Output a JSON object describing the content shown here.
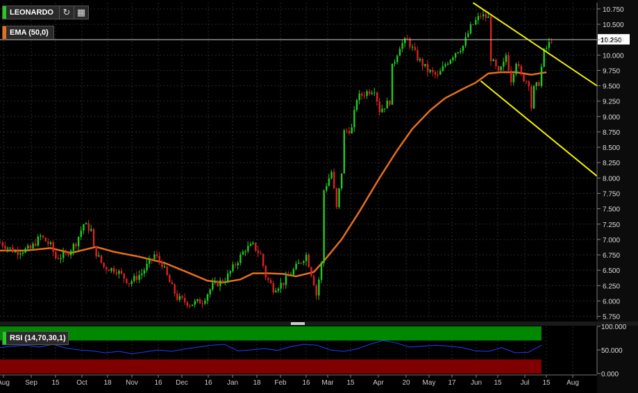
{
  "instrument": "LEONARDO",
  "indicators": {
    "ema_label": "EMA (50,0)",
    "rsi_label": "RSI (14,70,30,1)"
  },
  "icons": {
    "refresh": "refresh-icon",
    "calendar": "calendar-icon"
  },
  "colors": {
    "up": "#22cc22",
    "down": "#dd2222",
    "ema": "#e8701a",
    "channel": "#f0f000",
    "rsi_line": "#1f3fff",
    "rsi_overbought": "#008800",
    "rsi_oversold": "#800000",
    "instrument_accent": "#22cc22",
    "ema_accent": "#e8701a",
    "rsi_accent": "#22cc22"
  },
  "chart_data": [
    {
      "type": "candlestick",
      "series": [
        {
          "name": "LEONARDO"
        },
        {
          "name": "EMA (50,0)"
        }
      ],
      "ylim": [
        5.7,
        10.85
      ],
      "y_ticks": [
        "10.750",
        "10.500",
        "10.250",
        "10.000",
        "9.750",
        "9.500",
        "9.250",
        "9.000",
        "8.750",
        "8.500",
        "8.250",
        "8.000",
        "7.750",
        "7.500",
        "7.250",
        "7.000",
        "6.750",
        "6.500",
        "6.250",
        "6.000",
        "5.750"
      ],
      "x_ticks": [
        "Aug",
        "Sep",
        "15",
        "Oct",
        "18",
        "Nov",
        "16",
        "Dec",
        "16",
        "Jan",
        "18",
        "Feb",
        "16",
        "Mar",
        "15",
        "Apr",
        "20",
        "May",
        "17",
        "Jun",
        "15",
        "Jul",
        "15",
        "Aug"
      ],
      "last_price": "10.250",
      "price_path": [
        [
          0,
          6.95
        ],
        [
          6,
          6.8
        ],
        [
          12,
          6.85
        ],
        [
          16,
          7.05
        ],
        [
          20,
          6.9
        ],
        [
          22,
          6.7
        ],
        [
          26,
          6.75
        ],
        [
          30,
          6.95
        ],
        [
          33,
          7.25
        ],
        [
          36,
          7.15
        ],
        [
          37,
          6.85
        ],
        [
          41,
          6.55
        ],
        [
          46,
          6.5
        ],
        [
          51,
          6.3
        ],
        [
          56,
          6.45
        ],
        [
          61,
          6.75
        ],
        [
          64,
          6.6
        ],
        [
          67,
          6.3
        ],
        [
          70,
          6.05
        ],
        [
          75,
          5.95
        ],
        [
          80,
          6.0
        ],
        [
          84,
          6.25
        ],
        [
          89,
          6.35
        ],
        [
          93,
          6.6
        ],
        [
          97,
          6.85
        ],
        [
          100,
          6.9
        ],
        [
          103,
          6.75
        ],
        [
          105,
          6.4
        ],
        [
          108,
          6.2
        ],
        [
          112,
          6.3
        ],
        [
          117,
          6.55
        ],
        [
          121,
          6.75
        ],
        [
          124,
          6.3
        ],
        [
          125,
          6.1
        ],
        [
          127,
          6.6
        ],
        [
          128,
          7.8
        ],
        [
          131,
          8.1
        ],
        [
          133,
          7.5
        ],
        [
          135,
          8.1
        ],
        [
          136,
          8.75
        ],
        [
          139,
          8.8
        ],
        [
          141,
          9.3
        ],
        [
          145,
          9.4
        ],
        [
          148,
          9.45
        ],
        [
          150,
          9.1
        ],
        [
          154,
          9.25
        ],
        [
          155,
          9.8
        ],
        [
          158,
          10.15
        ],
        [
          161,
          10.25
        ],
        [
          165,
          9.95
        ],
        [
          169,
          9.75
        ],
        [
          173,
          9.65
        ],
        [
          176,
          9.85
        ],
        [
          180,
          10.05
        ],
        [
          183,
          10.15
        ],
        [
          186,
          10.45
        ],
        [
          188,
          10.55
        ],
        [
          190,
          10.65
        ],
        [
          193,
          10.6
        ],
        [
          194,
          9.95
        ],
        [
          197,
          9.7
        ],
        [
          199,
          9.85
        ],
        [
          200,
          10.0
        ],
        [
          202,
          9.6
        ],
        [
          204,
          9.9
        ],
        [
          206,
          9.65
        ],
        [
          209,
          9.55
        ],
        [
          210,
          9.15
        ],
        [
          211,
          9.45
        ],
        [
          213,
          9.55
        ],
        [
          215,
          10.05
        ],
        [
          218,
          10.25
        ]
      ],
      "ema_path": [
        [
          0,
          6.82
        ],
        [
          10,
          6.82
        ],
        [
          20,
          6.86
        ],
        [
          28,
          6.78
        ],
        [
          38,
          6.88
        ],
        [
          45,
          6.8
        ],
        [
          55,
          6.72
        ],
        [
          65,
          6.62
        ],
        [
          75,
          6.45
        ],
        [
          82,
          6.33
        ],
        [
          88,
          6.3
        ],
        [
          95,
          6.35
        ],
        [
          100,
          6.45
        ],
        [
          106,
          6.45
        ],
        [
          112,
          6.44
        ],
        [
          117,
          6.4
        ],
        [
          124,
          6.47
        ],
        [
          128,
          6.65
        ],
        [
          135,
          7.0
        ],
        [
          142,
          7.45
        ],
        [
          150,
          8.0
        ],
        [
          157,
          8.45
        ],
        [
          163,
          8.8
        ],
        [
          170,
          9.1
        ],
        [
          176,
          9.3
        ],
        [
          183,
          9.45
        ],
        [
          188,
          9.55
        ],
        [
          193,
          9.7
        ],
        [
          198,
          9.72
        ],
        [
          204,
          9.72
        ],
        [
          210,
          9.68
        ],
        [
          216,
          9.72
        ]
      ],
      "channel_upper": [
        [
          187,
          10.85
        ],
        [
          236,
          9.5
        ]
      ],
      "channel_lower": [
        [
          190,
          9.58
        ],
        [
          236,
          8.03
        ]
      ]
    },
    {
      "type": "line",
      "series": [
        {
          "name": "RSI (14,70,30,1)"
        }
      ],
      "y_ticks": [
        "100.000",
        "50.000",
        "0.000"
      ],
      "ylim": [
        0,
        100
      ],
      "overbought": 70,
      "oversold": 30,
      "values": [
        55,
        58,
        60,
        56,
        62,
        54,
        50,
        48,
        44,
        47,
        42,
        46,
        50,
        47,
        52,
        56,
        60,
        62,
        48,
        50,
        53,
        49,
        57,
        62,
        60,
        50,
        47,
        52,
        62,
        70,
        65,
        56,
        58,
        60,
        58,
        55,
        48,
        47,
        55,
        44,
        45,
        60
      ]
    }
  ]
}
